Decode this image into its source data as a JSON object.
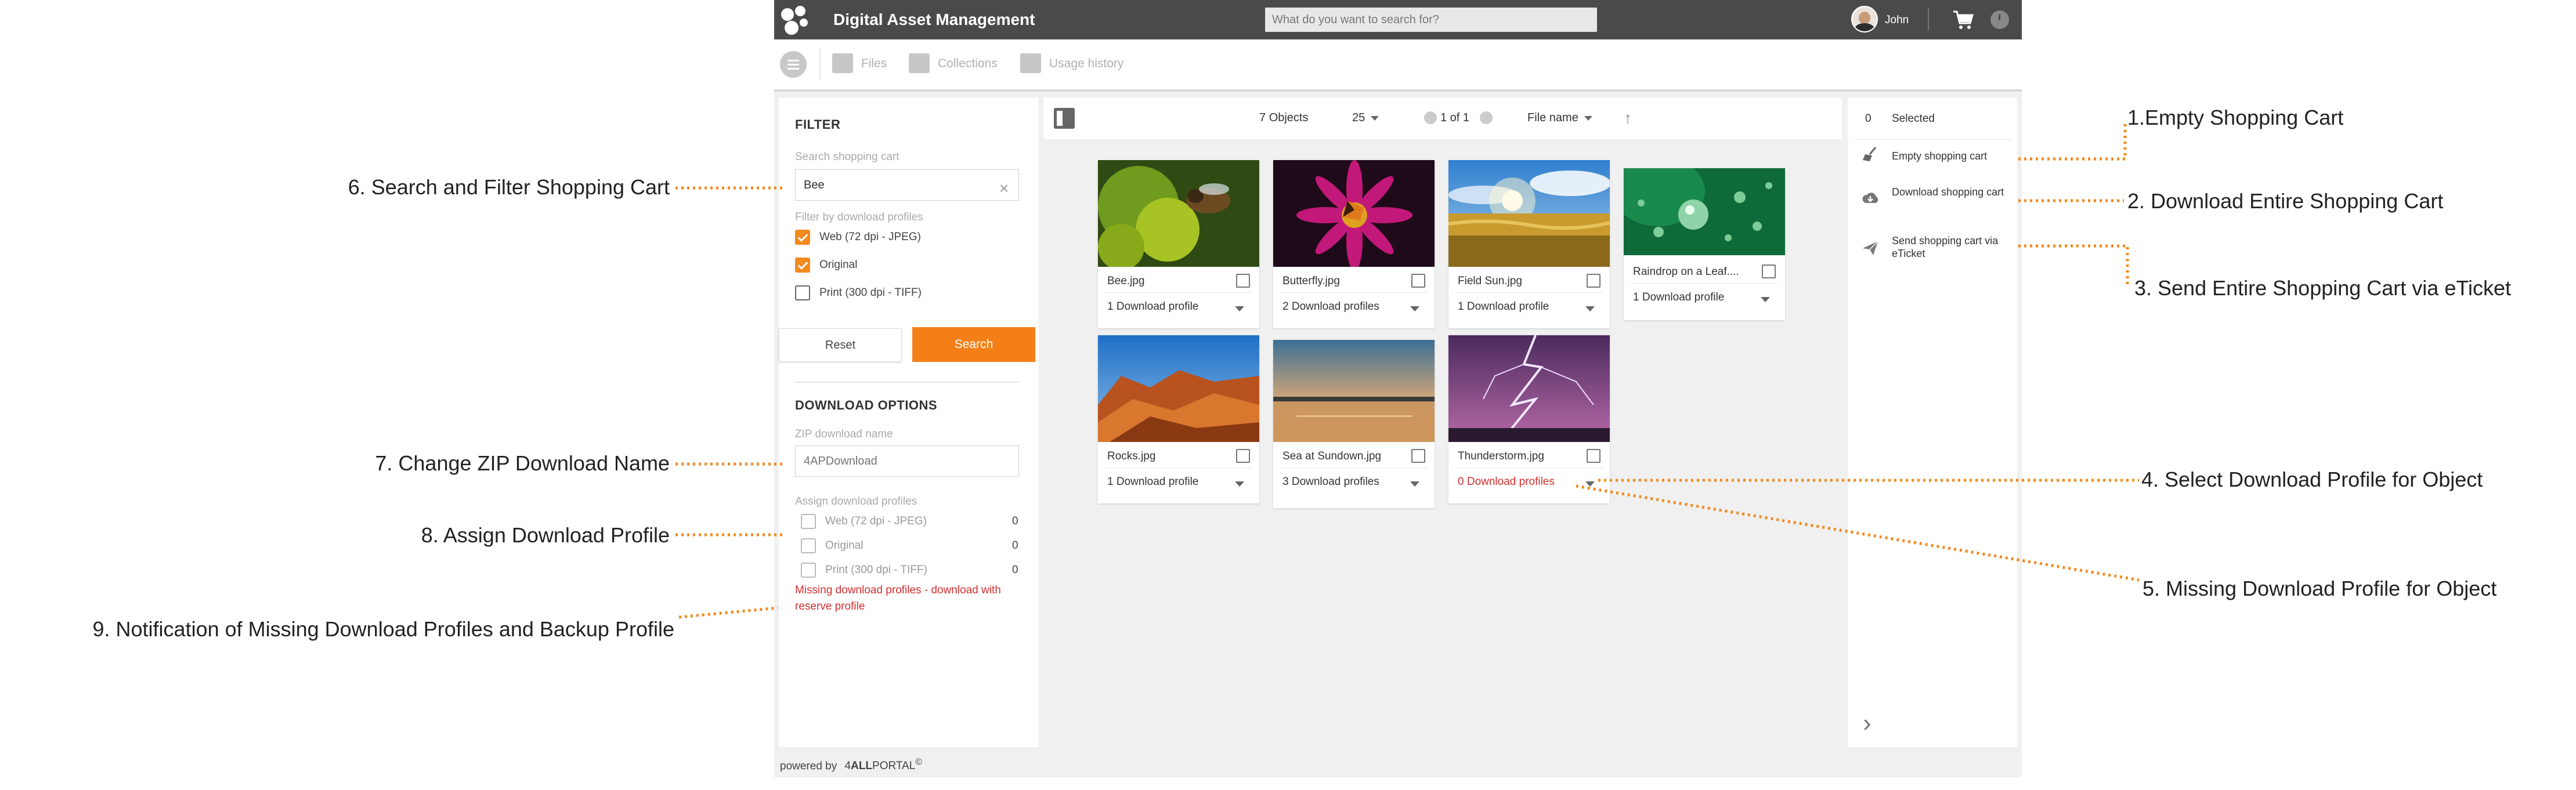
{
  "header": {
    "app_title": "Digital Asset Management",
    "search_placeholder": "What do you want to search for?",
    "user_name": "John"
  },
  "nav": {
    "items": [
      {
        "label": "Files",
        "icon": "image-icon"
      },
      {
        "label": "Collections",
        "icon": "collection-icon"
      },
      {
        "label": "Usage history",
        "icon": "history-icon"
      }
    ]
  },
  "filter": {
    "title": "FILTER",
    "search_label": "Search shopping cart",
    "search_value": "Bee",
    "profiles_label": "Filter by download profiles",
    "profiles": [
      {
        "label": "Web (72 dpi - JPEG)",
        "checked": true
      },
      {
        "label": "Original",
        "checked": true
      },
      {
        "label": "Print (300 dpi - TIFF)",
        "checked": false
      }
    ],
    "reset_label": "Reset",
    "search_button_label": "Search"
  },
  "download_options": {
    "title": "DOWNLOAD OPTIONS",
    "zip_label": "ZIP download name",
    "zip_placeholder": "4APDownload",
    "assign_label": "Assign download profiles",
    "assign_profiles": [
      {
        "label": "Web (72 dpi - JPEG)",
        "count": "0"
      },
      {
        "label": "Original",
        "count": "0"
      },
      {
        "label": "Print (300 dpi - TIFF)",
        "count": "0"
      }
    ],
    "missing_notice": "Missing download profiles - download with reserve profile"
  },
  "toolbar": {
    "objects_count": "7",
    "objects_label": "Objects",
    "page_size": "25",
    "pagination": "1 of 1",
    "sort_field": "File name"
  },
  "objects": [
    {
      "name": "Bee.jpg",
      "profile": "1 Download profile",
      "missing": false
    },
    {
      "name": "Butterfly.jpg",
      "profile": "2 Download profiles",
      "missing": false
    },
    {
      "name": "Field Sun.jpg",
      "profile": "1 Download profile",
      "missing": false
    },
    {
      "name": "Raindrop on a Leaf....",
      "profile": "1 Download profile",
      "missing": false
    },
    {
      "name": "Rocks.jpg",
      "profile": "1 Download profile",
      "missing": false
    },
    {
      "name": "Sea at Sundown.jpg",
      "profile": "3 Download profiles",
      "missing": false
    },
    {
      "name": "Thunderstorm.jpg",
      "profile": "0 Download profiles",
      "missing": true
    }
  ],
  "cart_panel": {
    "selected_count": "0",
    "selected_label": "Selected",
    "actions": [
      {
        "label": "Empty shopping cart",
        "icon": "broom-icon"
      },
      {
        "label": "Download shopping cart",
        "icon": "cloud-download-icon"
      },
      {
        "label": "Send shopping cart via eTicket",
        "icon": "send-icon"
      }
    ]
  },
  "footer": {
    "powered_by": "powered by",
    "brand_prefix": "4",
    "brand_bold": "ALL",
    "brand_suffix": "PORTAL",
    "brand_mark": "©"
  },
  "callouts": [
    "1.Empty Shopping Cart",
    "2. Download Entire Shopping Cart",
    "3. Send Entire Shopping Cart via eTicket",
    "4. Select Download Profile for Object",
    "5. Missing Download Profile for Object",
    "6. Search and Filter Shopping Cart",
    "7. Change ZIP Download Name",
    "8. Assign Download Profile",
    "9. Notification of Missing Download Profiles and Backup Profile"
  ],
  "colors": {
    "accent": "#f57f17",
    "header_bg": "#4a4a4a",
    "warning": "#d32f2f",
    "leader_line": "#f28a1e"
  }
}
